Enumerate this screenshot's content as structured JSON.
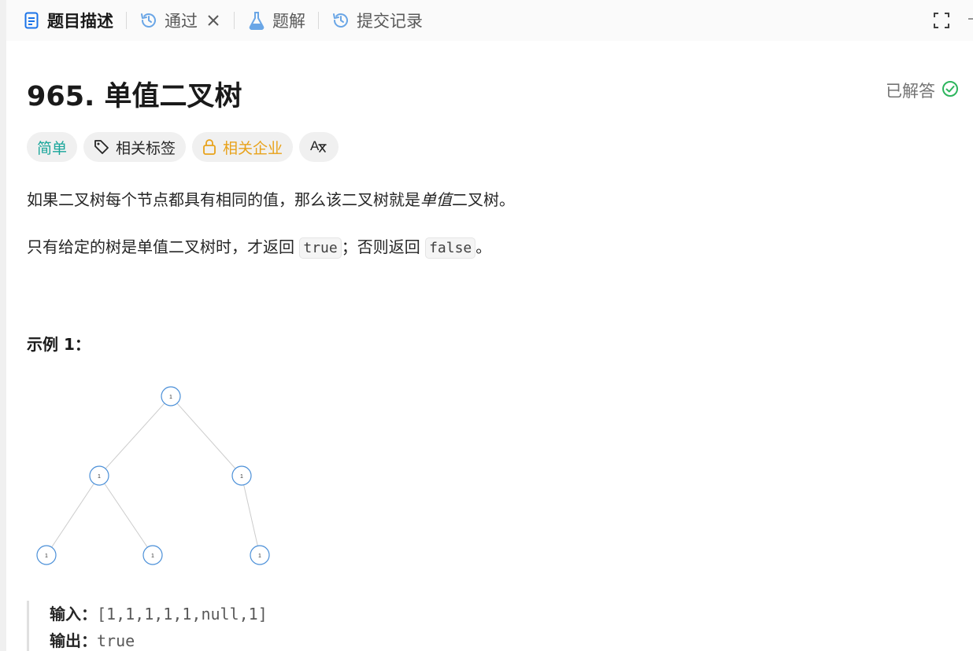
{
  "tabs": {
    "description": "题目描述",
    "passed": "通过",
    "solutions": "题解",
    "submissions": "提交记录"
  },
  "problem": {
    "title": "965. 单值二叉树",
    "status": "已解答",
    "tags": {
      "difficulty": "简单",
      "related_topics": "相关标签",
      "related_companies": "相关企业",
      "translate": "A"
    },
    "desc1_pre": "如果二叉树每个节点都具有相同的值，那么该二叉树就是",
    "desc1_em": "单值",
    "desc1_post": "二叉树。",
    "desc2_pre": "只有给定的树是单值二叉树时，才返回 ",
    "desc2_true": "true",
    "desc2_mid": "；否则返回 ",
    "desc2_false": "false",
    "desc2_end": "。"
  },
  "example": {
    "heading": "示例 1：",
    "tree_nodes": [
      "1",
      "1",
      "1",
      "1",
      "1",
      "1"
    ],
    "input_label": "输入：",
    "input_value": "[1,1,1,1,1,null,1]",
    "output_label": "输出：",
    "output_value": "true"
  },
  "colors": {
    "accent_blue": "#1a73e8",
    "easy": "#1aa69b",
    "company": "#e8a21a",
    "solved_green": "#2db55d",
    "node_stroke": "#4a8fd8"
  },
  "icons": [
    "document-icon",
    "history-icon",
    "close-icon",
    "flask-icon",
    "history-icon",
    "fullscreen-icon",
    "tag-icon",
    "lock-icon",
    "translate-icon",
    "check-circle-icon"
  ]
}
